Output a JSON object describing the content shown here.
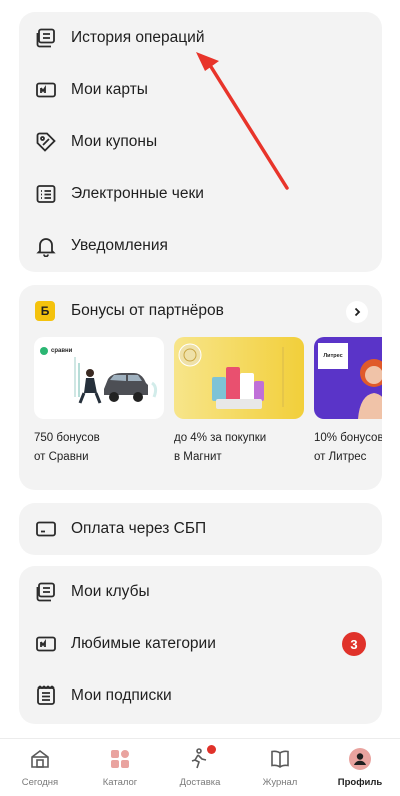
{
  "menu_top": [
    {
      "label": "История операций",
      "icon": "receipt-stack-icon"
    },
    {
      "label": "Мои карты",
      "icon": "card-icon"
    },
    {
      "label": "Мои купоны",
      "icon": "coupon-tag-icon"
    },
    {
      "label": "Электронные чеки",
      "icon": "list-receipt-icon"
    },
    {
      "label": "Уведомления",
      "icon": "bell-icon"
    }
  ],
  "bonus": {
    "logo_letter": "Б",
    "title": "Бонусы от партнёров",
    "partners": [
      {
        "line1": "750 бонусов",
        "line2": "от Сравни",
        "logo": "сравни"
      },
      {
        "line1": "до 4% за покупки",
        "line2": "в Магнит",
        "logo": ""
      },
      {
        "line1": "10% бонусов",
        "line2": "от Литрес",
        "logo": "Литрес"
      }
    ]
  },
  "sbp": {
    "label": "Оплата через СБП"
  },
  "menu_bottom": [
    {
      "label": "Мои клубы",
      "icon": "clubs-icon"
    },
    {
      "label": "Любимые категории",
      "icon": "card-icon",
      "badge": "3"
    },
    {
      "label": "Мои подписки",
      "icon": "subscription-icon"
    }
  ],
  "nav": [
    {
      "label": "Сегодня",
      "icon": "home-icon"
    },
    {
      "label": "Каталог",
      "icon": "catalog-icon"
    },
    {
      "label": "Доставка",
      "icon": "delivery-runner-icon"
    },
    {
      "label": "Журнал",
      "icon": "book-icon"
    },
    {
      "label": "Профиль",
      "icon": "profile-icon"
    }
  ],
  "colors": {
    "card_bg": "#f3f3f3",
    "accent_red": "#e0322a",
    "bonus_yellow": "#f4c20d"
  }
}
